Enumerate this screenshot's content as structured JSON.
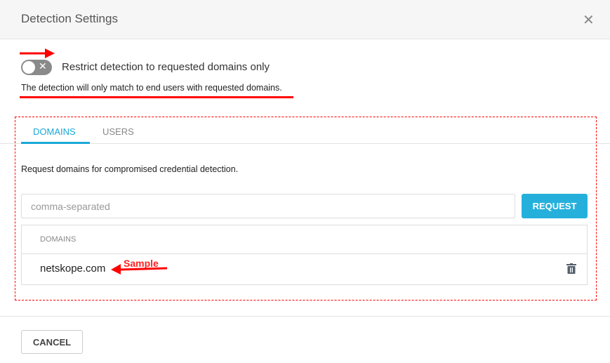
{
  "dialog": {
    "title": "Detection Settings"
  },
  "toggle": {
    "label": "Restrict detection to requested domains only",
    "on": false,
    "description": "The detection will only match to end users with requested domains."
  },
  "tabs": [
    {
      "label": "DOMAINS",
      "active": true
    },
    {
      "label": "USERS",
      "active": false
    }
  ],
  "domains_tab": {
    "instruction": "Request domains for compromised credential detection.",
    "input_placeholder": "comma-separated",
    "input_value": "",
    "request_label": "REQUEST",
    "table_header": "DOMAINS",
    "rows": [
      "netskope.com"
    ]
  },
  "annotation": {
    "sample_label": "Sample",
    "color": "#ff0000"
  },
  "footer": {
    "cancel_label": "CANCEL"
  },
  "colors": {
    "accent": "#1ba8d8"
  }
}
